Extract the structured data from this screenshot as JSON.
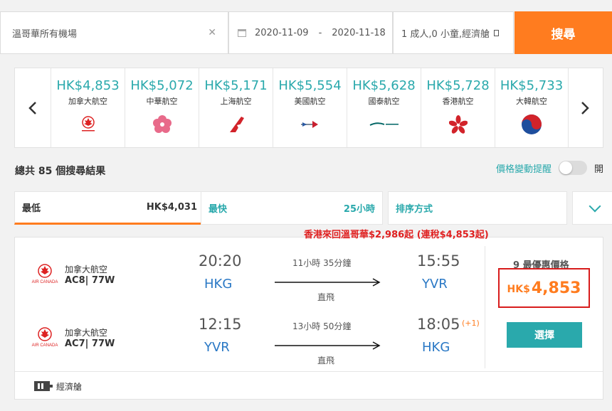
{
  "search": {
    "destination": "溫哥華所有機場",
    "clear_icon": "close-icon",
    "date_from": "2020-11-09",
    "date_separator": "-",
    "date_to": "2020-11-18",
    "passengers": "1 成人,0 小童,經濟艙",
    "search_label": "搜尋"
  },
  "carousel": {
    "items": [
      {
        "price": "HK$4,853",
        "airline": "加拿大航空",
        "logo": "air-canada-logo"
      },
      {
        "price": "HK$5,072",
        "airline": "中華航空",
        "logo": "china-airlines-logo"
      },
      {
        "price": "HK$5,171",
        "airline": "上海航空",
        "logo": "shanghai-airlines-logo"
      },
      {
        "price": "HK$5,554",
        "airline": "美國航空",
        "logo": "american-airlines-logo"
      },
      {
        "price": "HK$5,628",
        "airline": "國泰航空",
        "logo": "cathay-pacific-logo"
      },
      {
        "price": "HK$5,728",
        "airline": "香港航空",
        "logo": "hong-kong-airlines-logo"
      },
      {
        "price": "HK$5,733",
        "airline": "大韓航空",
        "logo": "korean-air-logo"
      }
    ]
  },
  "results": {
    "count_text": "總共 85 個搜尋結果",
    "alert_label": "價格變動提醒",
    "alert_state": "開"
  },
  "tabs": {
    "lowest_label": "最低",
    "lowest_value": "HK$4,031",
    "fastest_label": "最快",
    "fastest_value": "25小時",
    "sort_label": "排序方式"
  },
  "card": {
    "promo": "香港來回溫哥華$2,986起 (連稅$4,853起)",
    "outbound": {
      "airline": "加拿大航空",
      "flight": "AC8| 77W",
      "dep_time": "20:20",
      "dep_airport": "HKG",
      "duration": "11小時 35分鐘",
      "stops": "直飛",
      "arr_time": "15:55",
      "arr_airport": "YVR",
      "airline_logo_text": "AIR CANADA"
    },
    "inbound": {
      "airline": "加拿大航空",
      "flight": "AC7| 77W",
      "dep_time": "12:15",
      "dep_airport": "YVR",
      "duration": "13小時 50分鐘",
      "stops": "直飛",
      "arr_time": "18:05",
      "day_offset": "(+1)",
      "arr_airport": "HKG",
      "airline_logo_text": "AIR CANADA"
    },
    "deal_text": "9 最優惠價格",
    "currency": "HK$",
    "price": "4,853",
    "select_label": "選擇",
    "cabin": "經濟艙"
  },
  "colors": {
    "accent_orange": "#ff7c1f",
    "accent_teal": "#2aa9ac",
    "highlight_red": "#d81c1c",
    "airport_blue": "#2a78c5"
  }
}
